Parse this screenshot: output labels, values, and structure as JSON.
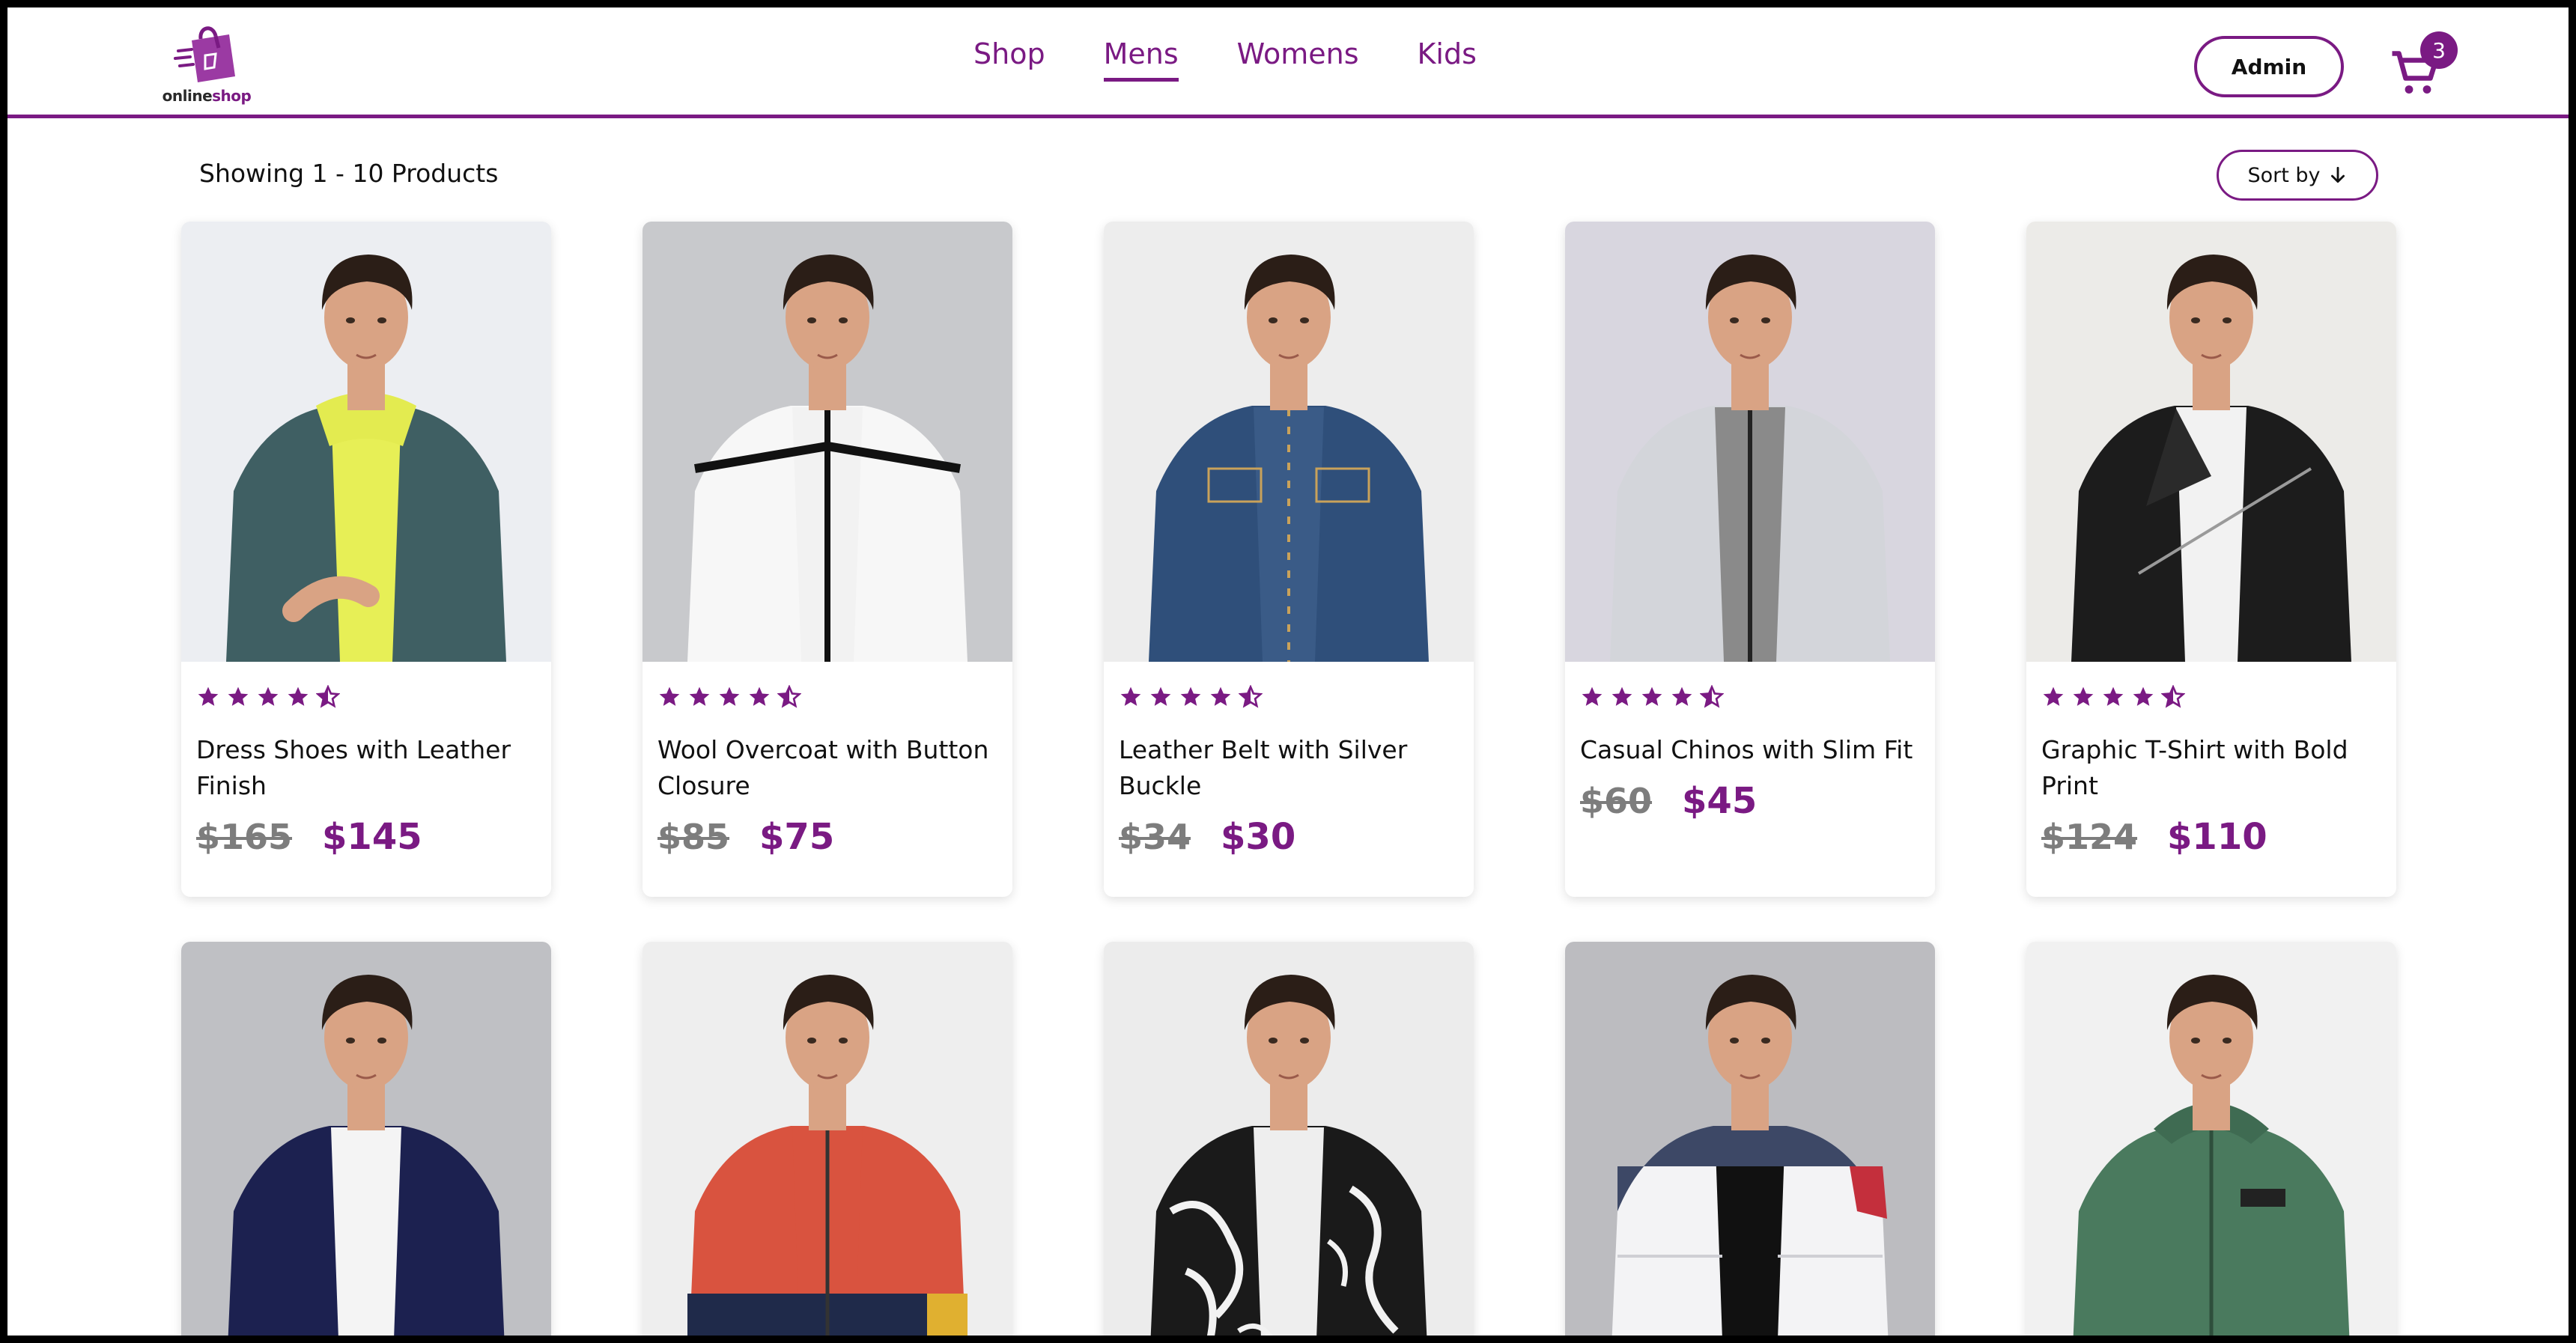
{
  "header": {
    "logo_text_a": "online",
    "logo_text_b": "shop",
    "nav": [
      {
        "label": "Shop"
      },
      {
        "label": "Mens"
      },
      {
        "label": "Womens"
      },
      {
        "label": "Kids"
      }
    ],
    "active_nav": "Mens",
    "admin_label": "Admin",
    "cart_count": "3"
  },
  "toolbar": {
    "showing_text": "Showing 1 - 10 Products",
    "sort_label": "Sort by"
  },
  "colors": {
    "brand": "#7a1a83",
    "old_price": "#7d7d7d"
  },
  "rating": {
    "stars_full": 4,
    "stars_half": 1
  },
  "products": [
    {
      "name": "Dress Shoes with Leather Finish",
      "old_price": "$165",
      "price": "$145",
      "photo": "teal-denim-jacket-yellow-hoodie"
    },
    {
      "name": "Wool Overcoat with Button Closure",
      "old_price": "$85",
      "price": "$75",
      "photo": "white-zip-jacket-black-stripe"
    },
    {
      "name": "Leather Belt with Silver Buckle",
      "old_price": "$34",
      "price": "$30",
      "photo": "blue-denim-jacket"
    },
    {
      "name": "Casual Chinos with Slim Fit",
      "old_price": "$60",
      "price": "$45",
      "photo": "light-grey-zip-jacket"
    },
    {
      "name": "Graphic T-Shirt with Bold Print",
      "old_price": "$124",
      "price": "$110",
      "photo": "black-leather-biker-jacket"
    },
    {
      "photo": "navy-zip-jacket-white-tee"
    },
    {
      "photo": "red-navy-colorblock-hooded-jacket"
    },
    {
      "photo": "black-white-marble-print-bomber"
    },
    {
      "photo": "white-navy-puffer-jacket"
    },
    {
      "photo": "green-zip-hoodie"
    }
  ]
}
